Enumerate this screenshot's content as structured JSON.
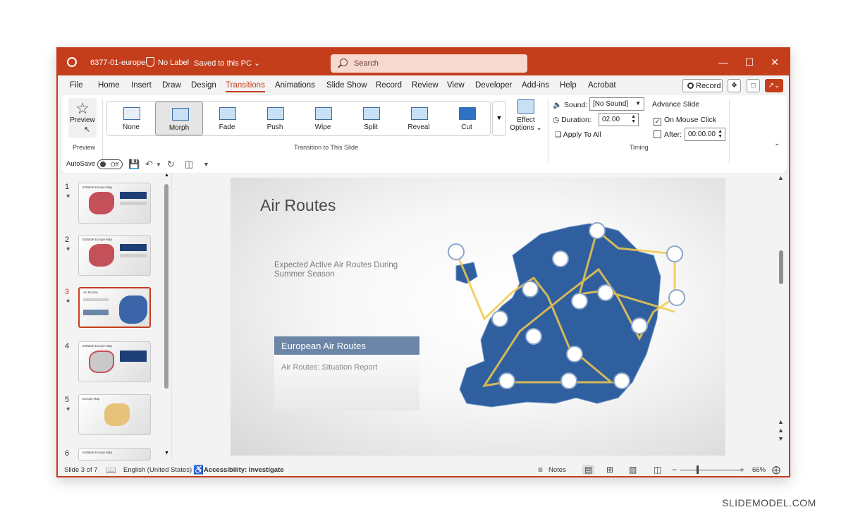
{
  "window": {
    "doc_title": "6377-01-europe",
    "label_text": "No Label",
    "saved_text": "Saved to this PC ⌄",
    "search_placeholder": "Search",
    "minimize": "—",
    "maximize": "☐",
    "close": "✕"
  },
  "menu": {
    "tabs": [
      "File",
      "Home",
      "Insert",
      "Draw",
      "Design",
      "Transitions",
      "Animations",
      "Slide Show",
      "Record",
      "Review",
      "View",
      "Developer",
      "Add-ins",
      "Help",
      "Acrobat"
    ],
    "active_tab": "Transitions",
    "record_label": "Record"
  },
  "ribbon": {
    "preview_label": "Preview",
    "preview_group": "Preview",
    "transitions": [
      "None",
      "Morph",
      "Fade",
      "Push",
      "Wipe",
      "Split",
      "Reveal",
      "Cut"
    ],
    "selected_transition": "Morph",
    "transition_group": "Transition to This Slide",
    "effect_options_line1": "Effect",
    "effect_options_line2": "Options ⌄",
    "sound_label": "Sound:",
    "sound_value": "[No Sound]",
    "duration_label": "Duration:",
    "duration_value": "02.00",
    "apply_all": "Apply To All",
    "advance_title": "Advance Slide",
    "on_mouse_click": "On Mouse Click",
    "on_mouse_click_checked": true,
    "after_label": "After:",
    "after_value": "00:00.00",
    "after_checked": false,
    "timing_group": "Timing"
  },
  "qat": {
    "autosave_label": "AutoSave",
    "autosave_state": "Off"
  },
  "thumbnails": [
    {
      "num": "1",
      "star": "★",
      "title": "Editable Europe Map"
    },
    {
      "num": "2",
      "star": "★",
      "title": "Editable Europe Map"
    },
    {
      "num": "3",
      "star": "★",
      "title": "Air Routes"
    },
    {
      "num": "4",
      "star": "",
      "title": "Editable Europe Map"
    },
    {
      "num": "5",
      "star": "★",
      "title": "Europe Map"
    },
    {
      "num": "6",
      "star": "",
      "title": "Editable Europe Map"
    }
  ],
  "active_slide_index": 2,
  "slide": {
    "title": "Air Routes",
    "subtitle": "Expected Active Air Routes During Summer Season",
    "box_title": "European Air Routes",
    "box_body": "Air Routes: Situation Report"
  },
  "status": {
    "slide_info": "Slide 3 of 7",
    "language": "English (United States)",
    "accessibility": "Accessibility: Investigate",
    "notes": "Notes",
    "zoom": "66%",
    "zoom_level": 0.66
  },
  "watermark": "SLIDEMODEL.COM",
  "colors": {
    "accent": "#c43e1c",
    "map_blue": "#2f5f9e",
    "route_yellow": "#f2c94c"
  }
}
